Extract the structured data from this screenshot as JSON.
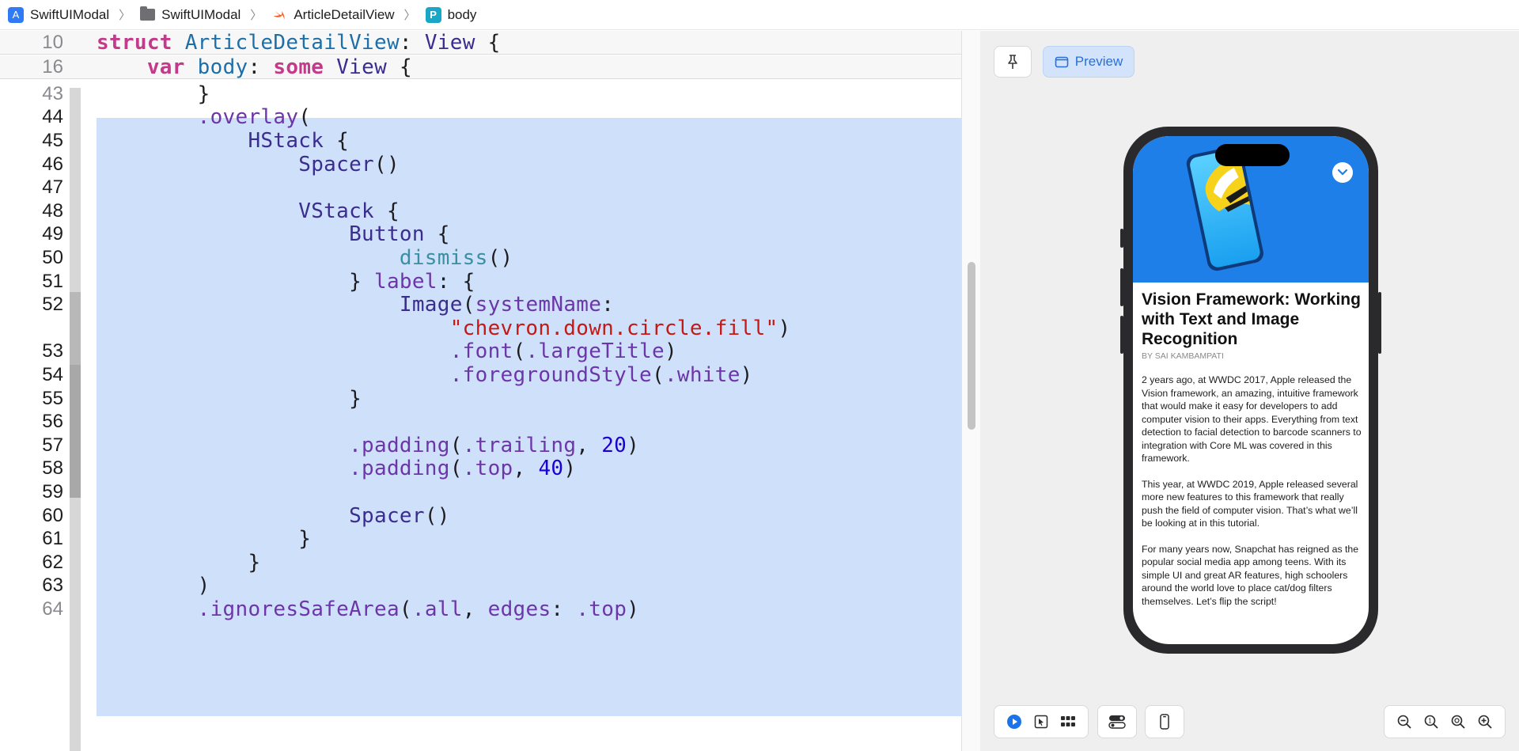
{
  "breadcrumb": {
    "items": [
      {
        "label": "SwiftUIModal",
        "icon": "app-icon"
      },
      {
        "label": "SwiftUIModal",
        "icon": "folder-icon"
      },
      {
        "label": "ArticleDetailView",
        "icon": "swift-file-icon"
      },
      {
        "label": "body",
        "icon": "property-icon",
        "badge": "P"
      }
    ],
    "separator": "〉"
  },
  "editor": {
    "sticky_lines": [
      {
        "number": "10",
        "code": "struct ArticleDetailView: View {"
      },
      {
        "number": "16",
        "code": "    var body: some View {"
      }
    ],
    "lines": [
      {
        "number": "43",
        "code": "        }"
      },
      {
        "number": "44",
        "code": "        .overlay("
      },
      {
        "number": "45",
        "code": "            HStack {"
      },
      {
        "number": "46",
        "code": "                Spacer()"
      },
      {
        "number": "47",
        "code": ""
      },
      {
        "number": "48",
        "code": "                VStack {"
      },
      {
        "number": "49",
        "code": "                    Button {"
      },
      {
        "number": "50",
        "code": "                        dismiss()"
      },
      {
        "number": "51",
        "code": "                    } label: {"
      },
      {
        "number": "52",
        "code": "                        Image(systemName:"
      },
      {
        "number": "",
        "code": "                            \"chevron.down.circle.fill\")"
      },
      {
        "number": "53",
        "code": "                            .font(.largeTitle)"
      },
      {
        "number": "54",
        "code": "                            .foregroundStyle(.white)"
      },
      {
        "number": "55",
        "code": "                    }"
      },
      {
        "number": "56",
        "code": ""
      },
      {
        "number": "57",
        "code": "                    .padding(.trailing, 20)"
      },
      {
        "number": "58",
        "code": "                    .padding(.top, 40)"
      },
      {
        "number": "59",
        "code": ""
      },
      {
        "number": "60",
        "code": "                    Spacer()"
      },
      {
        "number": "61",
        "code": "                }"
      },
      {
        "number": "62",
        "code": "            }"
      },
      {
        "number": "63",
        "code": "        )"
      },
      {
        "number": "64",
        "code": "        .ignoresSafeArea(.all, edges: .top)"
      }
    ]
  },
  "preview": {
    "pin_icon": "pin-icon",
    "preview_label": "Preview",
    "article": {
      "title": "Vision Framework: Working with Text and Image Recognition",
      "byline": "BY SAI KAMBAMPATI",
      "paragraphs": [
        "2 years ago, at WWDC 2017, Apple released the Vision framework, an amazing, intuitive framework that would make it easy for developers to add computer vision to their apps. Everything from text detection to facial detection to barcode scanners to integration with Core ML was covered in this framework.",
        "This year, at WWDC 2019, Apple released several more new features to this framework that really push the field of computer vision. That’s what we’ll be looking at in this tutorial.",
        "For many years now, Snapchat has reigned as the popular social media app among teens. With its simple UI and great AR features, high schoolers around the world love to place cat/dog filters themselves. Let’s flip the script!"
      ]
    },
    "bottom_bar": {
      "group1": [
        "live-play-icon",
        "selectable-cursor-icon",
        "variants-grid-icon"
      ],
      "group2": [
        "device-settings-icon"
      ],
      "group3": [
        "device-icon"
      ],
      "zoom": [
        "zoom-out-icon",
        "zoom-to-fit-icon",
        "zoom-100-icon",
        "zoom-in-icon"
      ]
    }
  },
  "colors": {
    "selection": "#cfe0fb",
    "keyword": "#c33a8a",
    "string": "#c41a16",
    "number": "#1c00cf",
    "accent": "#2a6fd6",
    "hero_blue": "#1f7fe8"
  }
}
